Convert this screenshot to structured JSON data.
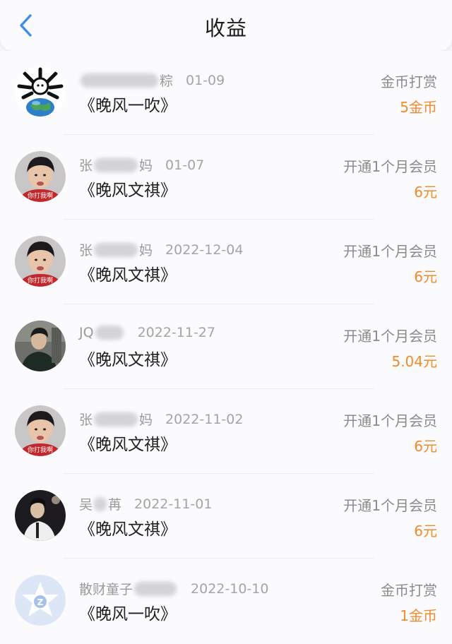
{
  "header": {
    "title": "收益",
    "back_icon": "chevron-left-icon",
    "accent": "#3b8fe6"
  },
  "colors": {
    "amount": "#f08a2c"
  },
  "rows": [
    {
      "name_pre": "",
      "name_post": "粽",
      "date": "01-09",
      "work": "《晚风一吹》",
      "type": "金币打赏",
      "amount": "5金币",
      "avatar": "emblem-earth"
    },
    {
      "name_pre": "张",
      "name_post": "妈",
      "date": "01-07",
      "work": "《晚风文祺》",
      "type": "开通1个月会员",
      "amount": "6元",
      "avatar": "portrait-red"
    },
    {
      "name_pre": "张",
      "name_post": "妈",
      "date": "2022-12-04",
      "work": "《晚风文祺》",
      "type": "开通1个月会员",
      "amount": "6元",
      "avatar": "portrait-red"
    },
    {
      "name_pre": "JQ",
      "name_post": "",
      "date": "2022-11-27",
      "work": "《晚风文祺》",
      "type": "开通1个月会员",
      "amount": "5.04元",
      "avatar": "portrait-dark"
    },
    {
      "name_pre": "张",
      "name_post": "妈",
      "date": "2022-11-02",
      "work": "《晚风文祺》",
      "type": "开通1个月会员",
      "amount": "6元",
      "avatar": "portrait-red"
    },
    {
      "name_pre": "吴",
      "name_post": "苒",
      "date": "2022-11-01",
      "work": "《晚风文祺》",
      "type": "开通1个月会员",
      "amount": "6元",
      "avatar": "portrait-stage"
    },
    {
      "name_pre": "散财童子",
      "name_post": "",
      "date": "2022-10-10",
      "work": "《晚风一吹》",
      "type": "金币打赏",
      "amount": "1金币",
      "avatar": "default-star"
    }
  ]
}
